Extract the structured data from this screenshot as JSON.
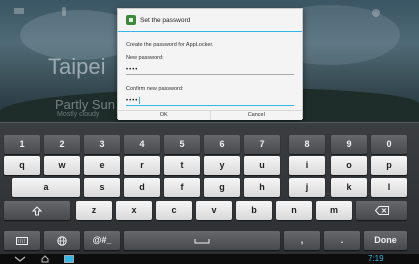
{
  "wallpaper": {
    "city": "Taipei",
    "weather": "Partly Sun",
    "weather_detail": "Mostly cloudy"
  },
  "dialog": {
    "title": "Set the password",
    "message": "Create the password for AppLocker.",
    "new_password_label": "New password:",
    "new_password_value": "••••",
    "confirm_label": "Confirm new password:",
    "confirm_value": "••••",
    "ok_label": "OK",
    "cancel_label": "Cancel",
    "accent_color": "#33b5e5"
  },
  "keyboard": {
    "row1": [
      "1",
      "2",
      "3",
      "4",
      "5",
      "6",
      "7",
      "8",
      "9",
      "0"
    ],
    "row2": [
      "q",
      "w",
      "e",
      "r",
      "t",
      "y",
      "u",
      "i",
      "o",
      "p"
    ],
    "row3": [
      "a",
      "s",
      "d",
      "f",
      "g",
      "h",
      "j",
      "k",
      "l"
    ],
    "row4": [
      "z",
      "x",
      "c",
      "v",
      "b",
      "n",
      "m"
    ],
    "symbols_label": "@#_",
    "comma": ",",
    "period": ".",
    "done_label": "Done",
    "icons": [
      "shift-icon",
      "backspace-icon",
      "keyboard-settings-icon",
      "globe-icon",
      "space-icon"
    ]
  },
  "status_bar": {
    "time": "7:19",
    "icons": [
      "back-icon",
      "home-icon",
      "recent-apps-icon"
    ]
  }
}
